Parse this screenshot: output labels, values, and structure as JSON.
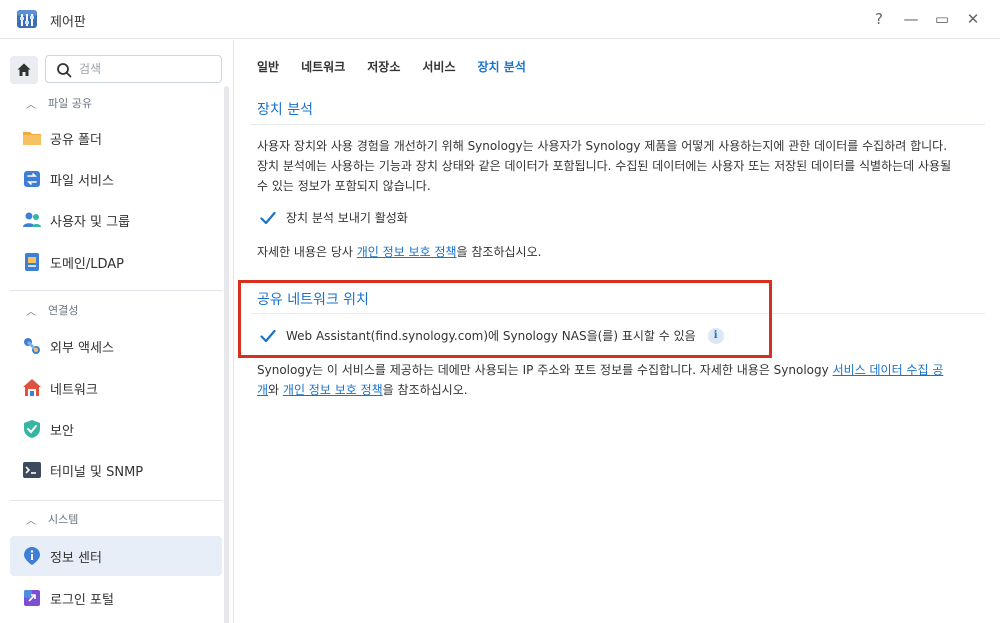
{
  "window": {
    "title": "제어판",
    "controls": {
      "help": "?",
      "minimize": "—",
      "maximize": "▭",
      "close": "✕"
    }
  },
  "sidebar": {
    "search_placeholder": "검색",
    "sections": [
      {
        "label": "파일 공유",
        "items": [
          "공유 폴더",
          "파일 서비스",
          "사용자 및 그룹",
          "도메인/LDAP"
        ]
      },
      {
        "label": "연결성",
        "items": [
          "외부 액세스",
          "네트워크",
          "보안",
          "터미널 및 SNMP"
        ]
      },
      {
        "label": "시스템",
        "items": [
          "정보 센터",
          "로그인 포털"
        ]
      }
    ],
    "active_item": "정보 센터"
  },
  "tabs": [
    "일반",
    "네트워크",
    "저장소",
    "서비스",
    "장치 분석"
  ],
  "active_tab": "장치 분석",
  "device_analytics": {
    "title": "장치 분석",
    "desc_line1": "사용자 장치와 사용 경험을 개선하기 위해 Synology는 사용자가 Synology 제품을 어떻게 사용하는지에 관한 데이터를 수집하려 합니다.",
    "desc_line2": "장치 분석에는 사용하는 기능과 장치 상태와 같은 데이터가 포함됩니다. 수집된 데이터에는 사용자 또는 저장된 데이터를 식별하는데 사용될",
    "desc_line3": "수 있는 정보가 포함되지 않습니다.",
    "checkbox_label": "장치 분석 보내기 활성화",
    "more_prefix": "자세한 내용은 당사 ",
    "more_link": "개인 정보 보호 정책",
    "more_suffix": "을 참조하십시오."
  },
  "network_location": {
    "title": "공유 네트워크 위치",
    "checkbox_label": "Web Assistant(find.synology.com)에 Synology NAS을(를) 표시할 수 있음",
    "info_icon": "i",
    "desc_line1_prefix": "Synology는 이 서비스를 제공하는 데에만 사용되는 IP 주소와 포트 정보를 수집합니다. 자세한 내용은 Synology ",
    "desc_link1_part1": "서비스 데이터 수집 공",
    "desc_link1_part2": "개",
    "desc_line2_mid": "와 ",
    "desc_link2": "개인 정보 보호 정책",
    "desc_line2_suffix": "을 참조하십시오."
  },
  "colors": {
    "accent": "#1a73c9",
    "highlight": "#d8301f",
    "active_bg": "#e8eef7"
  }
}
